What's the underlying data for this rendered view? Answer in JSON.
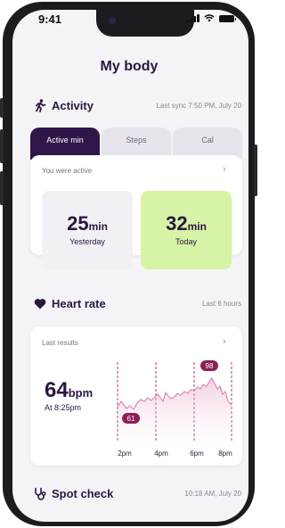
{
  "status_bar": {
    "time": "9:41"
  },
  "page": {
    "title": "My body"
  },
  "activity": {
    "title": "Activity",
    "sync_text": "Last sync 7:50 PM, July 20",
    "tabs": [
      {
        "label": "Active min",
        "active": true
      },
      {
        "label": "Steps",
        "active": false
      },
      {
        "label": "Cal",
        "active": false
      }
    ],
    "card": {
      "subtitle": "You were active",
      "yesterday": {
        "value": "25",
        "unit": "min",
        "label": "Yesterday"
      },
      "today": {
        "value": "32",
        "unit": "min",
        "label": "Today"
      }
    }
  },
  "heart_rate": {
    "title": "Heart rate",
    "meta": "Last 6 hours",
    "card": {
      "subtitle": "Last results",
      "value": "64",
      "unit": "bpm",
      "at": "At 8:25pm",
      "min_label": "61",
      "max_label": "98",
      "ticks": [
        "2pm",
        "4pm",
        "6pm",
        "8pm"
      ]
    }
  },
  "spot_check": {
    "title": "Spot check",
    "meta": "10:18 AM, July 20"
  },
  "colors": {
    "brand_dark": "#2e1748",
    "accent_magenta": "#b23a74",
    "today_bg": "#d7f3a6",
    "yesterday_bg": "#f1f0f4",
    "background": "#f4f3f6"
  },
  "icons": {
    "activity": "running-person-icon",
    "heart_rate": "heart-icon",
    "spot_check": "stethoscope-icon",
    "chevron": "chevron-right-icon"
  }
}
